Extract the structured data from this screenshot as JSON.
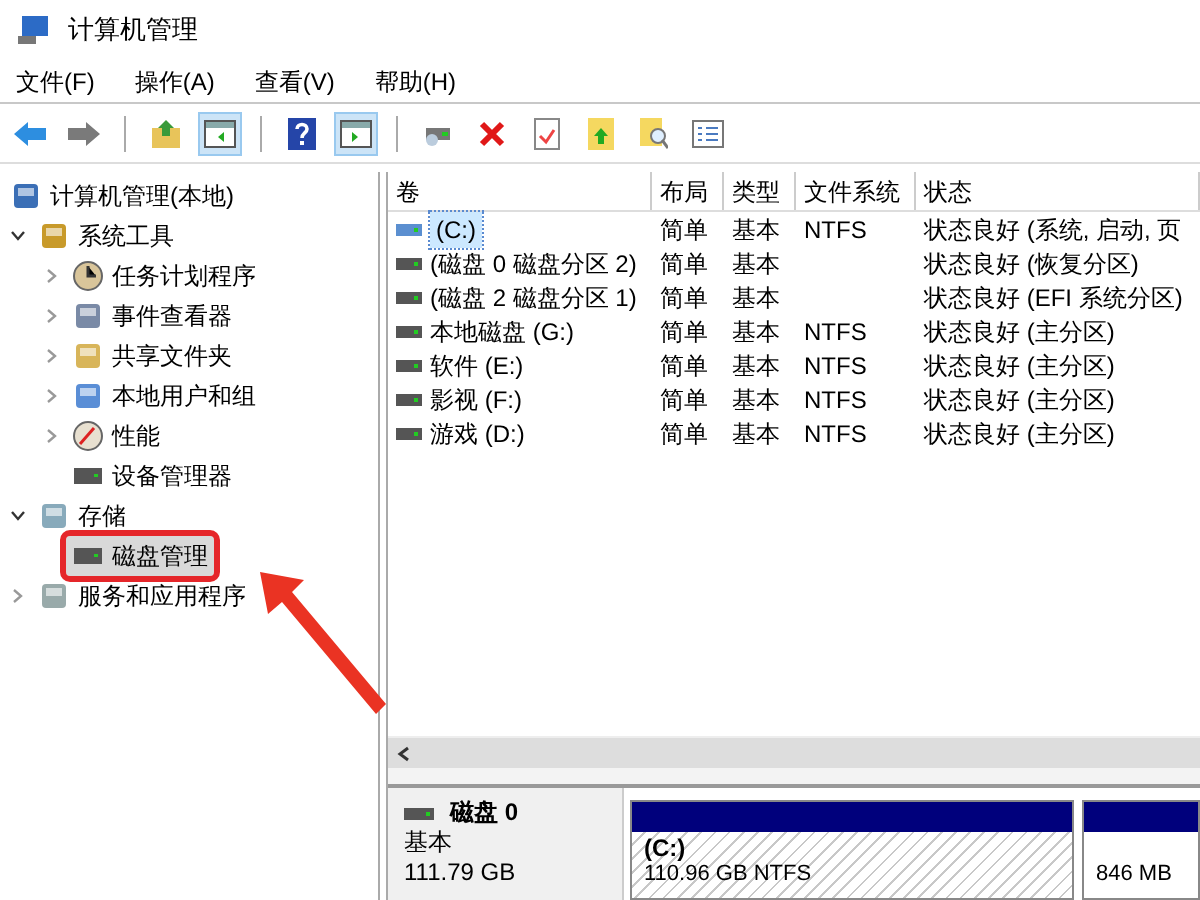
{
  "window": {
    "title": "计算机管理"
  },
  "menu": [
    "文件(F)",
    "操作(A)",
    "查看(V)",
    "帮助(H)"
  ],
  "toolbar": [
    {
      "kind": "back",
      "pressed": false
    },
    {
      "kind": "forward",
      "pressed": false
    },
    {
      "kind": "up",
      "pressed": false
    },
    {
      "kind": "tree",
      "pressed": true
    },
    {
      "kind": "help",
      "pressed": false
    },
    {
      "kind": "pane",
      "pressed": true
    },
    {
      "kind": "connect",
      "pressed": false
    },
    {
      "kind": "delete",
      "pressed": false
    },
    {
      "kind": "properties",
      "pressed": false
    },
    {
      "kind": "export",
      "pressed": false
    },
    {
      "kind": "find",
      "pressed": false
    },
    {
      "kind": "list",
      "pressed": false
    }
  ],
  "tree": [
    {
      "label": "计算机管理(本地)",
      "kind": "computer",
      "selected": false,
      "highlighted": false,
      "children": [
        {
          "label": "系统工具",
          "kind": "tools",
          "expanded": true,
          "selected": false,
          "highlighted": false,
          "children": [
            {
              "label": "任务计划程序",
              "kind": "clock",
              "expanded": false,
              "selected": false,
              "highlighted": false
            },
            {
              "label": "事件查看器",
              "kind": "log",
              "expanded": false,
              "selected": false,
              "highlighted": false
            },
            {
              "label": "共享文件夹",
              "kind": "folder",
              "expanded": false,
              "selected": false,
              "highlighted": false
            },
            {
              "label": "本地用户和组",
              "kind": "users",
              "expanded": false,
              "selected": false,
              "highlighted": false
            },
            {
              "label": "性能",
              "kind": "gauge",
              "expanded": false,
              "selected": false,
              "highlighted": false
            },
            {
              "label": "设备管理器",
              "kind": "device",
              "selected": false,
              "highlighted": false
            }
          ]
        },
        {
          "label": "存储",
          "kind": "storage",
          "expanded": true,
          "selected": false,
          "highlighted": false,
          "children": [
            {
              "label": "磁盘管理",
              "kind": "disk",
              "selected": true,
              "highlighted": true
            }
          ]
        },
        {
          "label": "服务和应用程序",
          "kind": "server",
          "expanded": false,
          "selected": false,
          "highlighted": false
        }
      ]
    }
  ],
  "table": {
    "columns": [
      "卷",
      "布局",
      "类型",
      "文件系统",
      "状态"
    ],
    "rows": [
      {
        "cells": [
          "(C:)",
          "简单",
          "基本",
          "NTFS",
          "状态良好 (系统, 启动, 页"
        ],
        "selected": true
      },
      {
        "cells": [
          "(磁盘 0 磁盘分区 2)",
          "简单",
          "基本",
          "",
          "状态良好 (恢复分区)"
        ],
        "selected": false
      },
      {
        "cells": [
          "(磁盘 2 磁盘分区 1)",
          "简单",
          "基本",
          "",
          "状态良好 (EFI 系统分区)"
        ],
        "selected": false
      },
      {
        "cells": [
          "本地磁盘 (G:)",
          "简单",
          "基本",
          "NTFS",
          "状态良好 (主分区)"
        ],
        "selected": false
      },
      {
        "cells": [
          "软件 (E:)",
          "简单",
          "基本",
          "NTFS",
          "状态良好 (主分区)"
        ],
        "selected": false
      },
      {
        "cells": [
          "影视 (F:)",
          "简单",
          "基本",
          "NTFS",
          "状态良好 (主分区)"
        ],
        "selected": false
      },
      {
        "cells": [
          "游戏 (D:)",
          "简单",
          "基本",
          "NTFS",
          "状态良好 (主分区)"
        ],
        "selected": false
      }
    ]
  },
  "disk": {
    "name": "磁盘 0",
    "type": "基本",
    "size": "111.79 GB",
    "partitions": [
      {
        "label": "(C:)",
        "detail": "110.96 GB NTFS",
        "hatched": true
      },
      {
        "detail": "846 MB",
        "hatched": false
      }
    ]
  }
}
